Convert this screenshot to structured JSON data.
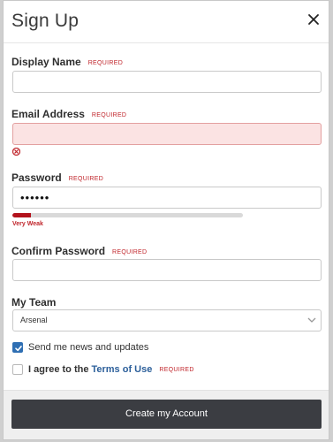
{
  "dialog": {
    "title": "Sign Up",
    "close_icon": "close-icon"
  },
  "required_text": "REQUIRED",
  "fields": {
    "display_name": {
      "label": "Display Name",
      "value": ""
    },
    "email": {
      "label": "Email Address",
      "value": "",
      "state": "error"
    },
    "password": {
      "label": "Password",
      "value": "••••••",
      "strength_label": "Very Weak",
      "strength_fraction": 0.08
    },
    "confirm_password": {
      "label": "Confirm Password",
      "value": ""
    },
    "my_team": {
      "label": "My Team",
      "selected": "Arsenal"
    }
  },
  "checkboxes": {
    "news": {
      "label": "Send me news and updates",
      "checked": true
    },
    "terms": {
      "prefix": "I agree to the",
      "link": "Terms of Use",
      "checked": false
    }
  },
  "footer": {
    "submit_label": "Create my Account"
  },
  "colors": {
    "required": "#c0252b",
    "error_bg": "#fbe3e3",
    "strength_fill": "#b3121c",
    "primary_button": "#3b3d42",
    "link": "#2c5f9a",
    "checkbox_checked": "#2f6fb3"
  }
}
